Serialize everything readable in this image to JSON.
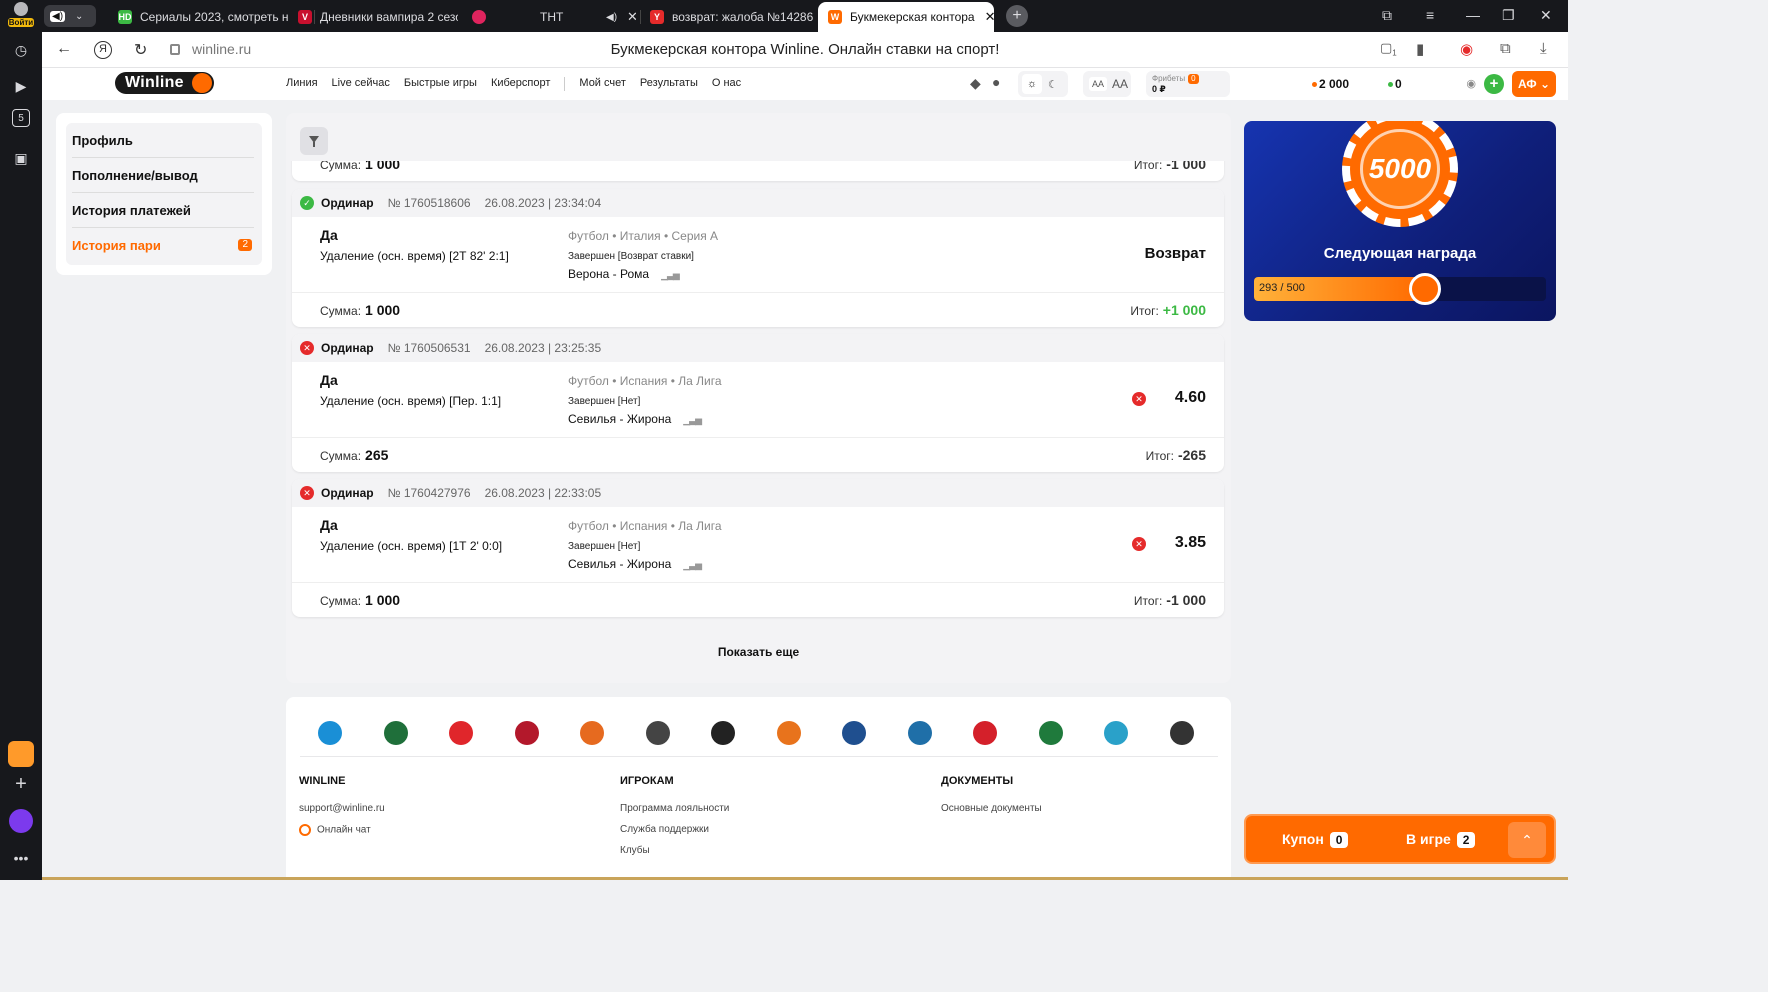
{
  "browser": {
    "login_label": "Войти",
    "rail_badge": "5",
    "tabs": [
      {
        "label": "Сериалы 2023, смотреть н",
        "favicon": "HD",
        "color": "#3cb944"
      },
      {
        "label": "Дневники вампира 2 сезо",
        "favicon": "V",
        "color": "#c8102e"
      },
      {
        "label": "",
        "favicon": "",
        "color": "#e0245e"
      },
      {
        "label": "ТНТ",
        "favicon": "",
        "color": "#17181c"
      },
      {
        "label": "возврат: жалоба №14286",
        "favicon": "Y",
        "color": "#e52b2b"
      },
      {
        "label": "Букмекерская контора",
        "favicon": "W",
        "color": "#ff6a00"
      }
    ],
    "url": "winline.ru",
    "page_title": "Букмекерская контора Winline. Онлайн ставки на спорт!",
    "ext_badge": "1"
  },
  "header": {
    "logo": "Winline",
    "nav": [
      "Линия",
      "Live сейчас",
      "Быстрые игры",
      "Киберспорт",
      "Мой счет",
      "Результаты",
      "О нас"
    ],
    "font_small": "AA",
    "font_large": "AA",
    "freebets_label": "Фрибеты",
    "freebets_count": "0",
    "freebets_value": "0 ₽",
    "balance_main": "2 000",
    "balance_bonus": "0",
    "account_label": "АФ"
  },
  "sidebar": {
    "items": [
      {
        "label": "Профиль"
      },
      {
        "label": "Пополнение/вывод"
      },
      {
        "label": "История платежей"
      },
      {
        "label": "История пари",
        "badge": "2"
      }
    ]
  },
  "bets": {
    "partial": {
      "sum_label": "Сумма:",
      "sum": "1 000",
      "total_label": "Итог:",
      "total": "-1 000"
    },
    "cards": [
      {
        "status": "ok",
        "type": "Ординар",
        "number": "№ 1760518606",
        "datetime": "26.08.2023 | 23:34:04",
        "pick": "Да",
        "market": "Удаление (осн. время) [2Т 82' 2:1]",
        "sport": "Футбол  •  Италия  •  Серия А",
        "state": "Завершен [Возврат ставки]",
        "match": "Верона - Рома",
        "result": "Возврат",
        "odds": "",
        "sum_label": "Сумма:",
        "sum": "1 000",
        "total_label": "Итог:",
        "total": "+1 000"
      },
      {
        "status": "bad",
        "type": "Ординар",
        "number": "№ 1760506531",
        "datetime": "26.08.2023 | 23:25:35",
        "pick": "Да",
        "market": "Удаление (осн. время) [Пер. 1:1]",
        "sport": "Футбол  •  Испания  •  Ла Лига",
        "state": "Завершен [Нет]",
        "match": "Севилья - Жирона",
        "result": "",
        "odds": "4.60",
        "sum_label": "Сумма:",
        "sum": "265",
        "total_label": "Итог:",
        "total": "-265"
      },
      {
        "status": "bad",
        "type": "Ординар",
        "number": "№ 1760427976",
        "datetime": "26.08.2023 | 22:33:05",
        "pick": "Да",
        "market": "Удаление (осн. время) [1Т 2' 0:0]",
        "sport": "Футбол  •  Испания  •  Ла Лига",
        "state": "Завершен [Нет]",
        "match": "Севилья - Жирона",
        "result": "",
        "odds": "3.85",
        "sum_label": "Сумма:",
        "sum": "1 000",
        "total_label": "Итог:",
        "total": "-1 000"
      }
    ],
    "show_more": "Показать еще"
  },
  "footer": {
    "clubs": [
      {
        "name": "zenit",
        "color": "#1a8fd6"
      },
      {
        "name": "krasnodar",
        "color": "#1f6f3a"
      },
      {
        "name": "spartak",
        "color": "#e0262b"
      },
      {
        "name": "cska",
        "color": "#b3182b"
      },
      {
        "name": "unics",
        "color": "#e66a1f"
      },
      {
        "name": "gambit",
        "color": "#444444"
      },
      {
        "name": "tundra",
        "color": "#222222"
      },
      {
        "name": "virtus-pro",
        "color": "#e8731c"
      },
      {
        "name": "sibir",
        "color": "#1f4f8f"
      },
      {
        "name": "admiral",
        "color": "#1f6fa8"
      },
      {
        "name": "avangard",
        "color": "#d4202a"
      },
      {
        "name": "ak-bars",
        "color": "#1f7a3c"
      },
      {
        "name": "barys",
        "color": "#2aa1c9"
      },
      {
        "name": "traktor",
        "color": "#333333"
      }
    ],
    "col1_title": "WINLINE",
    "col1_items": [
      "support@winline.ru",
      "Онлайн чат"
    ],
    "col2_title": "ИГРОКАМ",
    "col2_items": [
      "Программа лояльности",
      "Служба поддержки",
      "Клубы"
    ],
    "col3_title": "ДОКУМЕНТЫ",
    "col3_items": [
      "Основные документы"
    ]
  },
  "reward": {
    "chip_value": "5000",
    "title": "Следующая награда",
    "progress_text": "293 / 500",
    "progress_fraction": 0.586
  },
  "coupon": {
    "coupon_label": "Купон",
    "coupon_count": "0",
    "ingame_label": "В игре",
    "ingame_count": "2"
  },
  "colors": {
    "accent": "#ff6a00",
    "positive": "#3cb944",
    "negative": "#e52b2b"
  }
}
